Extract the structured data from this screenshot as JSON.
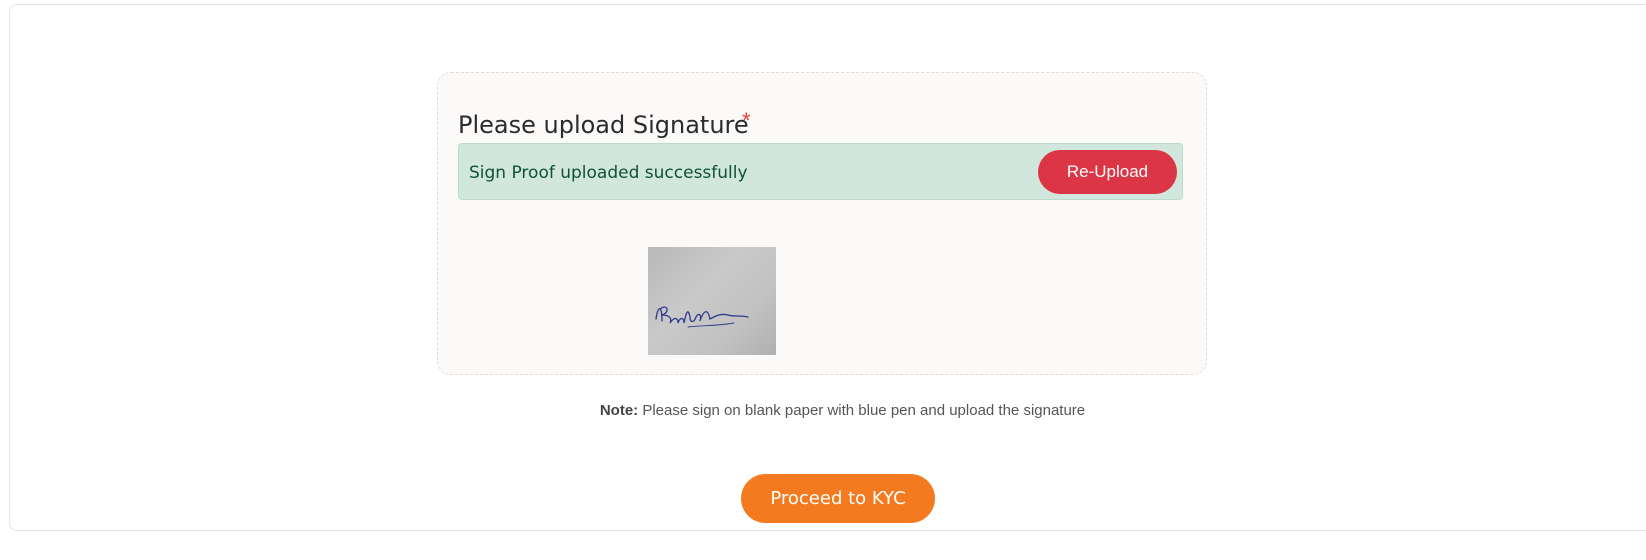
{
  "upload": {
    "title": "Please upload Signature",
    "required_marker": "*",
    "status_message": "Sign Proof uploaded successfully",
    "reupload_label": "Re-Upload"
  },
  "note": {
    "label": "Note:",
    "text": " Please sign on blank paper with blue pen and upload the signature"
  },
  "actions": {
    "proceed_label": "Proceed to KYC"
  },
  "colors": {
    "success_bg": "#d1e7dd",
    "danger": "#dc3545",
    "primary_orange": "#f47a20"
  }
}
